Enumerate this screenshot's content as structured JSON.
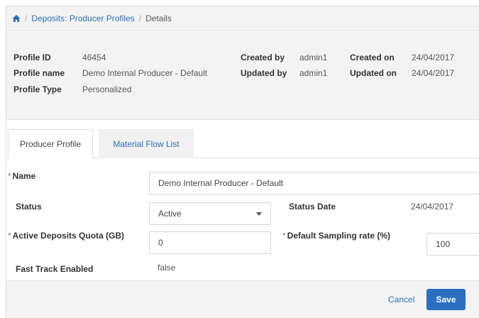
{
  "breadcrumb": {
    "home_icon": "home-icon",
    "separator": "/",
    "items": [
      "Deposits: Producer Profiles",
      "Details"
    ]
  },
  "summary": {
    "profile_id_label": "Profile ID",
    "profile_id_value": "46454",
    "profile_name_label": "Profile name",
    "profile_name_value": "Demo Internal Producer - Default",
    "profile_type_label": "Profile Type",
    "profile_type_value": "Personalized",
    "created_by_label": "Created by",
    "created_by_value": "admin1",
    "updated_by_label": "Updated by",
    "updated_by_value": "admin1",
    "created_on_label": "Created on",
    "created_on_value": "24/04/2017",
    "updated_on_label": "Updated on",
    "updated_on_value": "24/04/2017"
  },
  "tabs": [
    {
      "label": "Producer Profile",
      "active": true
    },
    {
      "label": "Material Flow List",
      "active": false
    }
  ],
  "form": {
    "required_marker": "*",
    "name_label": "Name",
    "name_value": "Demo Internal Producer - Default",
    "status_label": "Status",
    "status_value": "Active",
    "status_date_label": "Status Date",
    "status_date_value": "24/04/2017",
    "quota_label": "Active Deposits Quota (GB)",
    "quota_value": "0",
    "sampling_label": "Default Sampling rate (%)",
    "sampling_value": "100",
    "fast_track_label": "Fast Track Enabled",
    "fast_track_value": "false"
  },
  "footer": {
    "cancel_label": "Cancel",
    "save_label": "Save"
  },
  "colors": {
    "link": "#2a6fb3",
    "primary_button": "#2a6fc0",
    "panel_bg": "#f3f3f3"
  }
}
